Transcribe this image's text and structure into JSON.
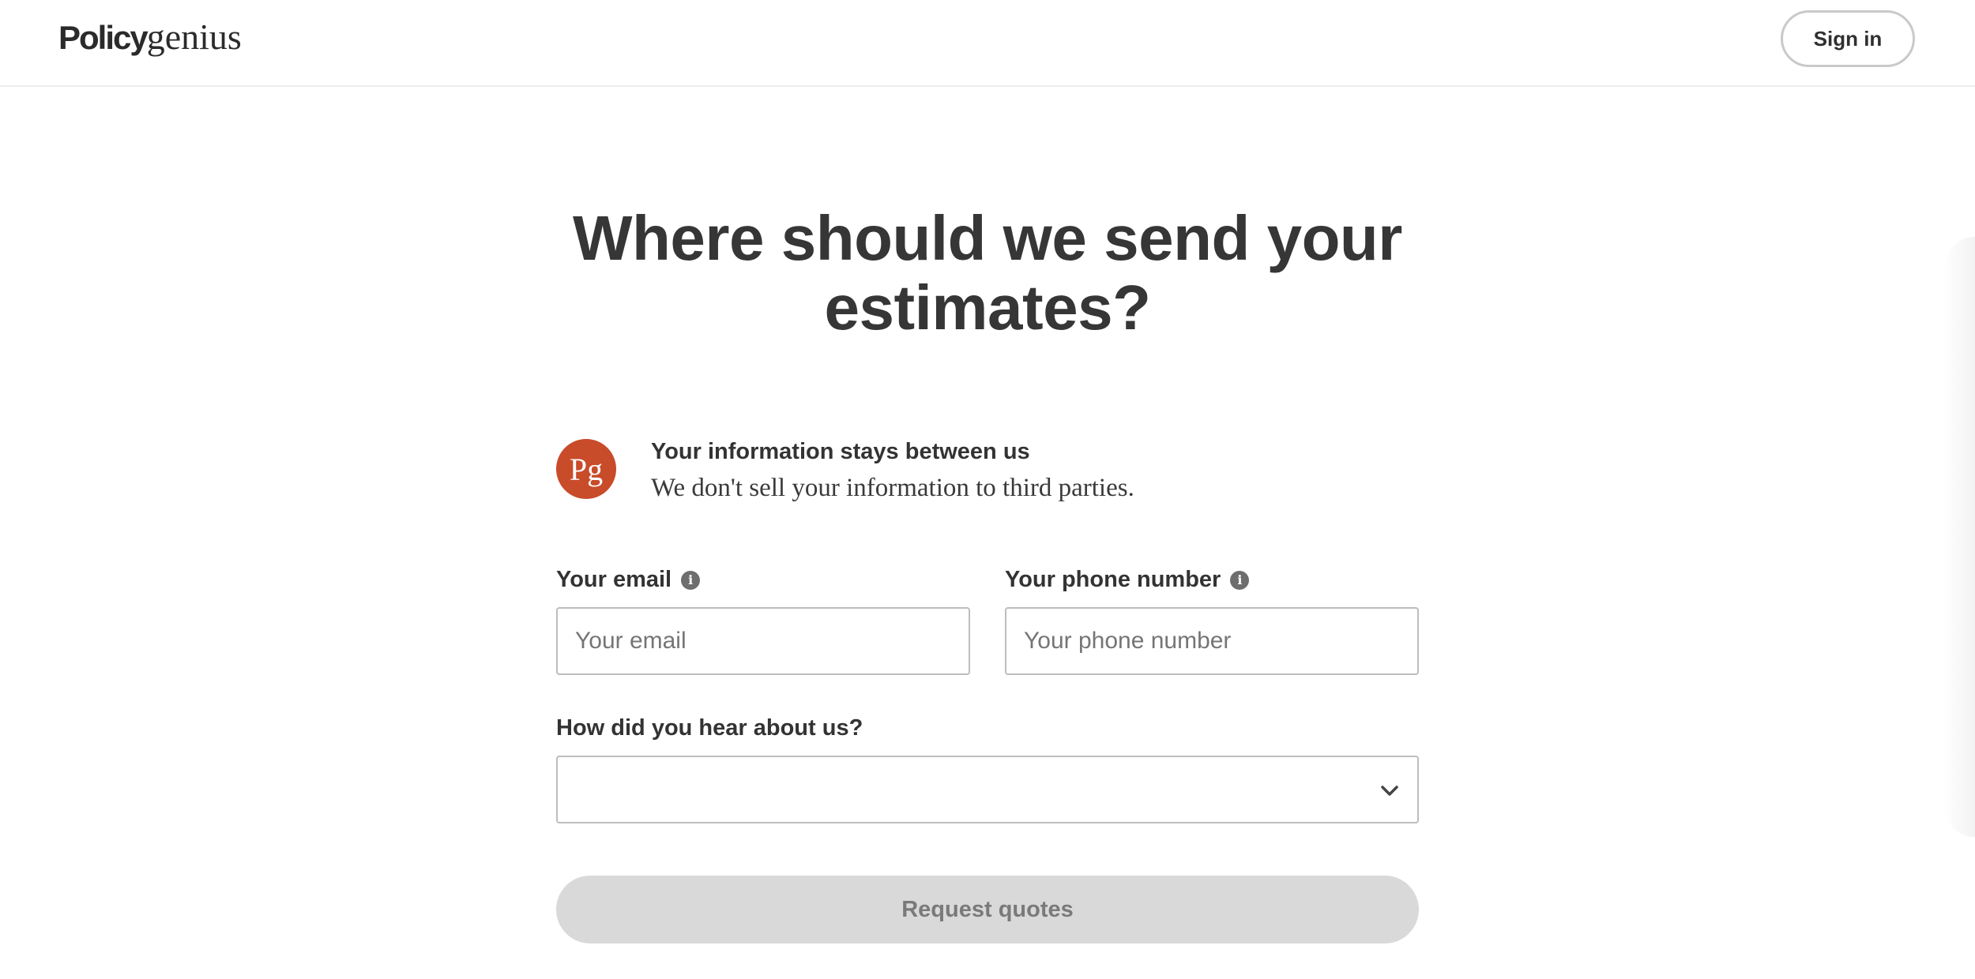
{
  "header": {
    "logo_bold": "Policy",
    "logo_serif": "genius",
    "signin_label": "Sign in"
  },
  "main": {
    "title": "Where should we send your estimates?",
    "trust": {
      "badge": "Pg",
      "title": "Your information stays between us",
      "text": "We don't sell your information to third parties."
    },
    "email": {
      "label": "Your email",
      "placeholder": "Your email",
      "value": ""
    },
    "phone": {
      "label": "Your phone number",
      "placeholder": "Your phone number",
      "value": ""
    },
    "referral": {
      "label": "How did you hear about us?",
      "selected": ""
    },
    "submit_label": "Request quotes"
  },
  "icons": {
    "info": "info-icon",
    "chevron": "chevron-down-icon"
  },
  "colors": {
    "brand_badge": "#c84b2a",
    "text_primary": "#333333",
    "button_disabled_bg": "#d9d9d9",
    "button_disabled_text": "#7a7a7a"
  }
}
